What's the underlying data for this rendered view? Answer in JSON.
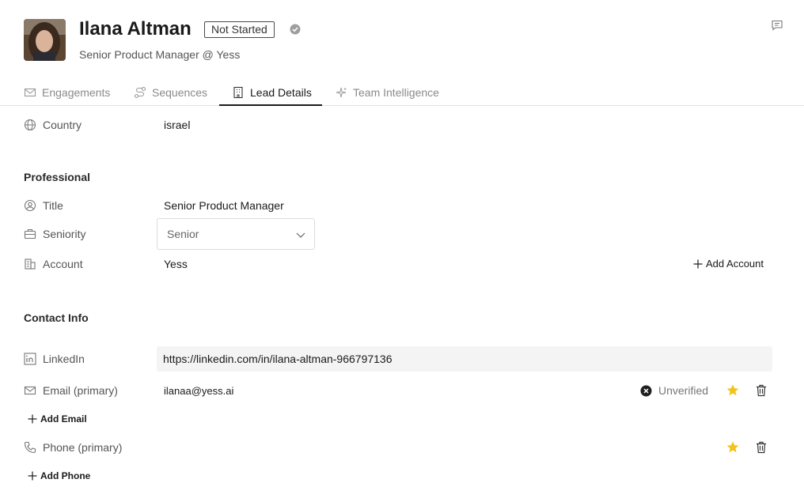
{
  "header": {
    "name": "Ilana Altman",
    "status": "Not Started",
    "subtitle": "Senior Product Manager @ Yess"
  },
  "tabs": [
    {
      "label": "Engagements",
      "icon": "mail-icon"
    },
    {
      "label": "Sequences",
      "icon": "sequence-icon"
    },
    {
      "label": "Lead Details",
      "icon": "building-icon",
      "active": true
    },
    {
      "label": "Team Intelligence",
      "icon": "sparkle-icon"
    }
  ],
  "location": {
    "country_label": "Country",
    "country_value": "israel"
  },
  "professional": {
    "section_title": "Professional",
    "title_label": "Title",
    "title_value": "Senior Product Manager",
    "seniority_label": "Seniority",
    "seniority_value": "Senior",
    "account_label": "Account",
    "account_value": "Yess",
    "add_account": "Add Account"
  },
  "contact": {
    "section_title": "Contact Info",
    "linkedin_label": "LinkedIn",
    "linkedin_value": "https://linkedin.com/in/ilana-altman-966797136",
    "email_label": "Email (primary)",
    "email_value": "ilanaa@yess.ai",
    "email_status": "Unverified",
    "add_email": "Add Email",
    "phone_label": "Phone (primary)",
    "add_phone": "Add Phone"
  },
  "colors": {
    "star": "#f2c31c",
    "text": "#1a1a1a",
    "muted": "#8a8a8a"
  }
}
